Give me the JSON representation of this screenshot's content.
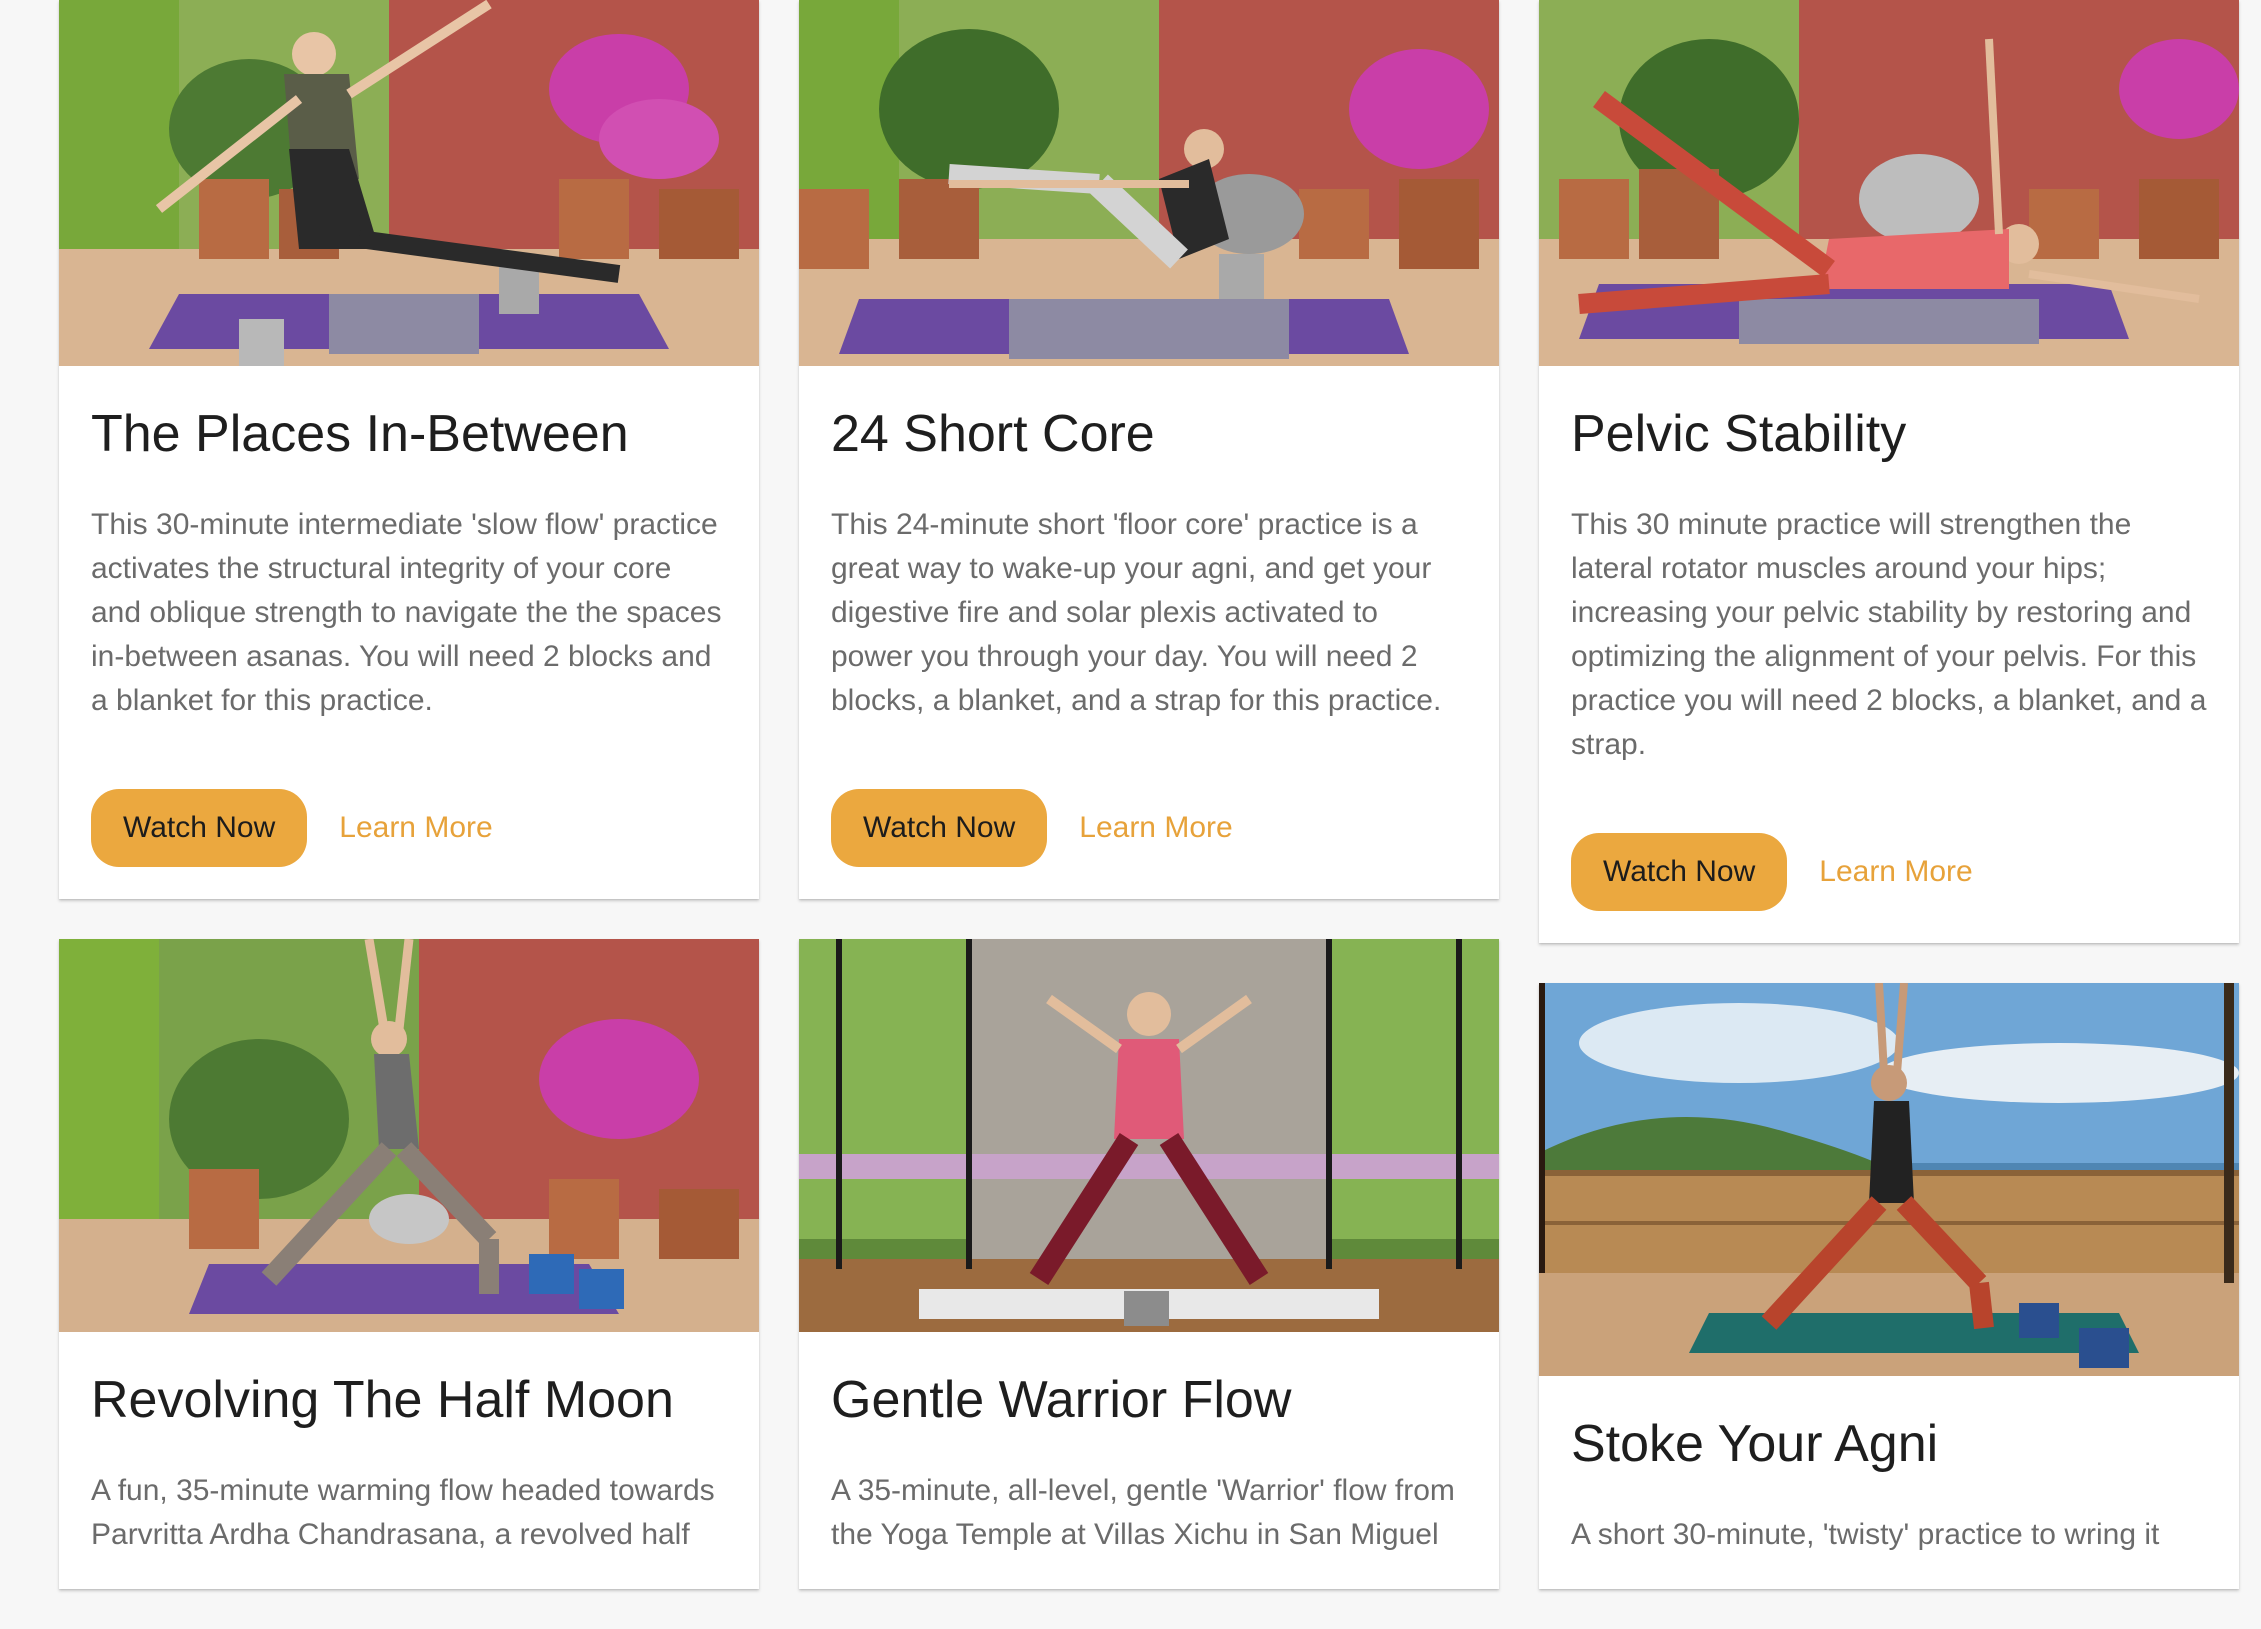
{
  "colors": {
    "accent": "#eba83f",
    "link": "#e7a23a",
    "title": "#1e1e1e",
    "text": "#6b6b6b"
  },
  "cards": [
    {
      "title": "The Places In-Between",
      "description": "This 30-minute intermediate 'slow flow' practice activates the structural integrity of your core and oblique strength to navigate the the spaces in-between asanas. You will need 2 blocks and a blanket for this practice.",
      "watch": "Watch Now",
      "learn": "Learn More"
    },
    {
      "title": "24 Short Core",
      "description": "This 24-minute short 'floor core' practice is a great way to wake-up your agni, and get your digestive fire and solar plexis activated to power you through your day. You will need 2 blocks, a blanket, and a strap for this practice.",
      "watch": "Watch Now",
      "learn": "Learn More"
    },
    {
      "title": "Pelvic Stability",
      "description": "This 30 minute practice will strengthen the lateral rotator muscles around your hips; increasing your pelvic stability by restoring and optimizing the alignment of your pelvis. For this practice you will need 2 blocks, a blanket, and a strap.",
      "watch": "Watch Now",
      "learn": "Learn More"
    },
    {
      "title": "Revolving The Half Moon",
      "description": "A fun, 35-minute warming flow headed towards Parvritta Ardha Chandrasana, a revolved half"
    },
    {
      "title": "Gentle Warrior Flow",
      "description": "A 35-minute, all-level, gentle 'Warrior' flow from the Yoga Temple at Villas Xichu in San Miguel"
    },
    {
      "title": "Stoke Your Agni",
      "description": "A short 30-minute, 'twisty' practice to wring it"
    }
  ]
}
